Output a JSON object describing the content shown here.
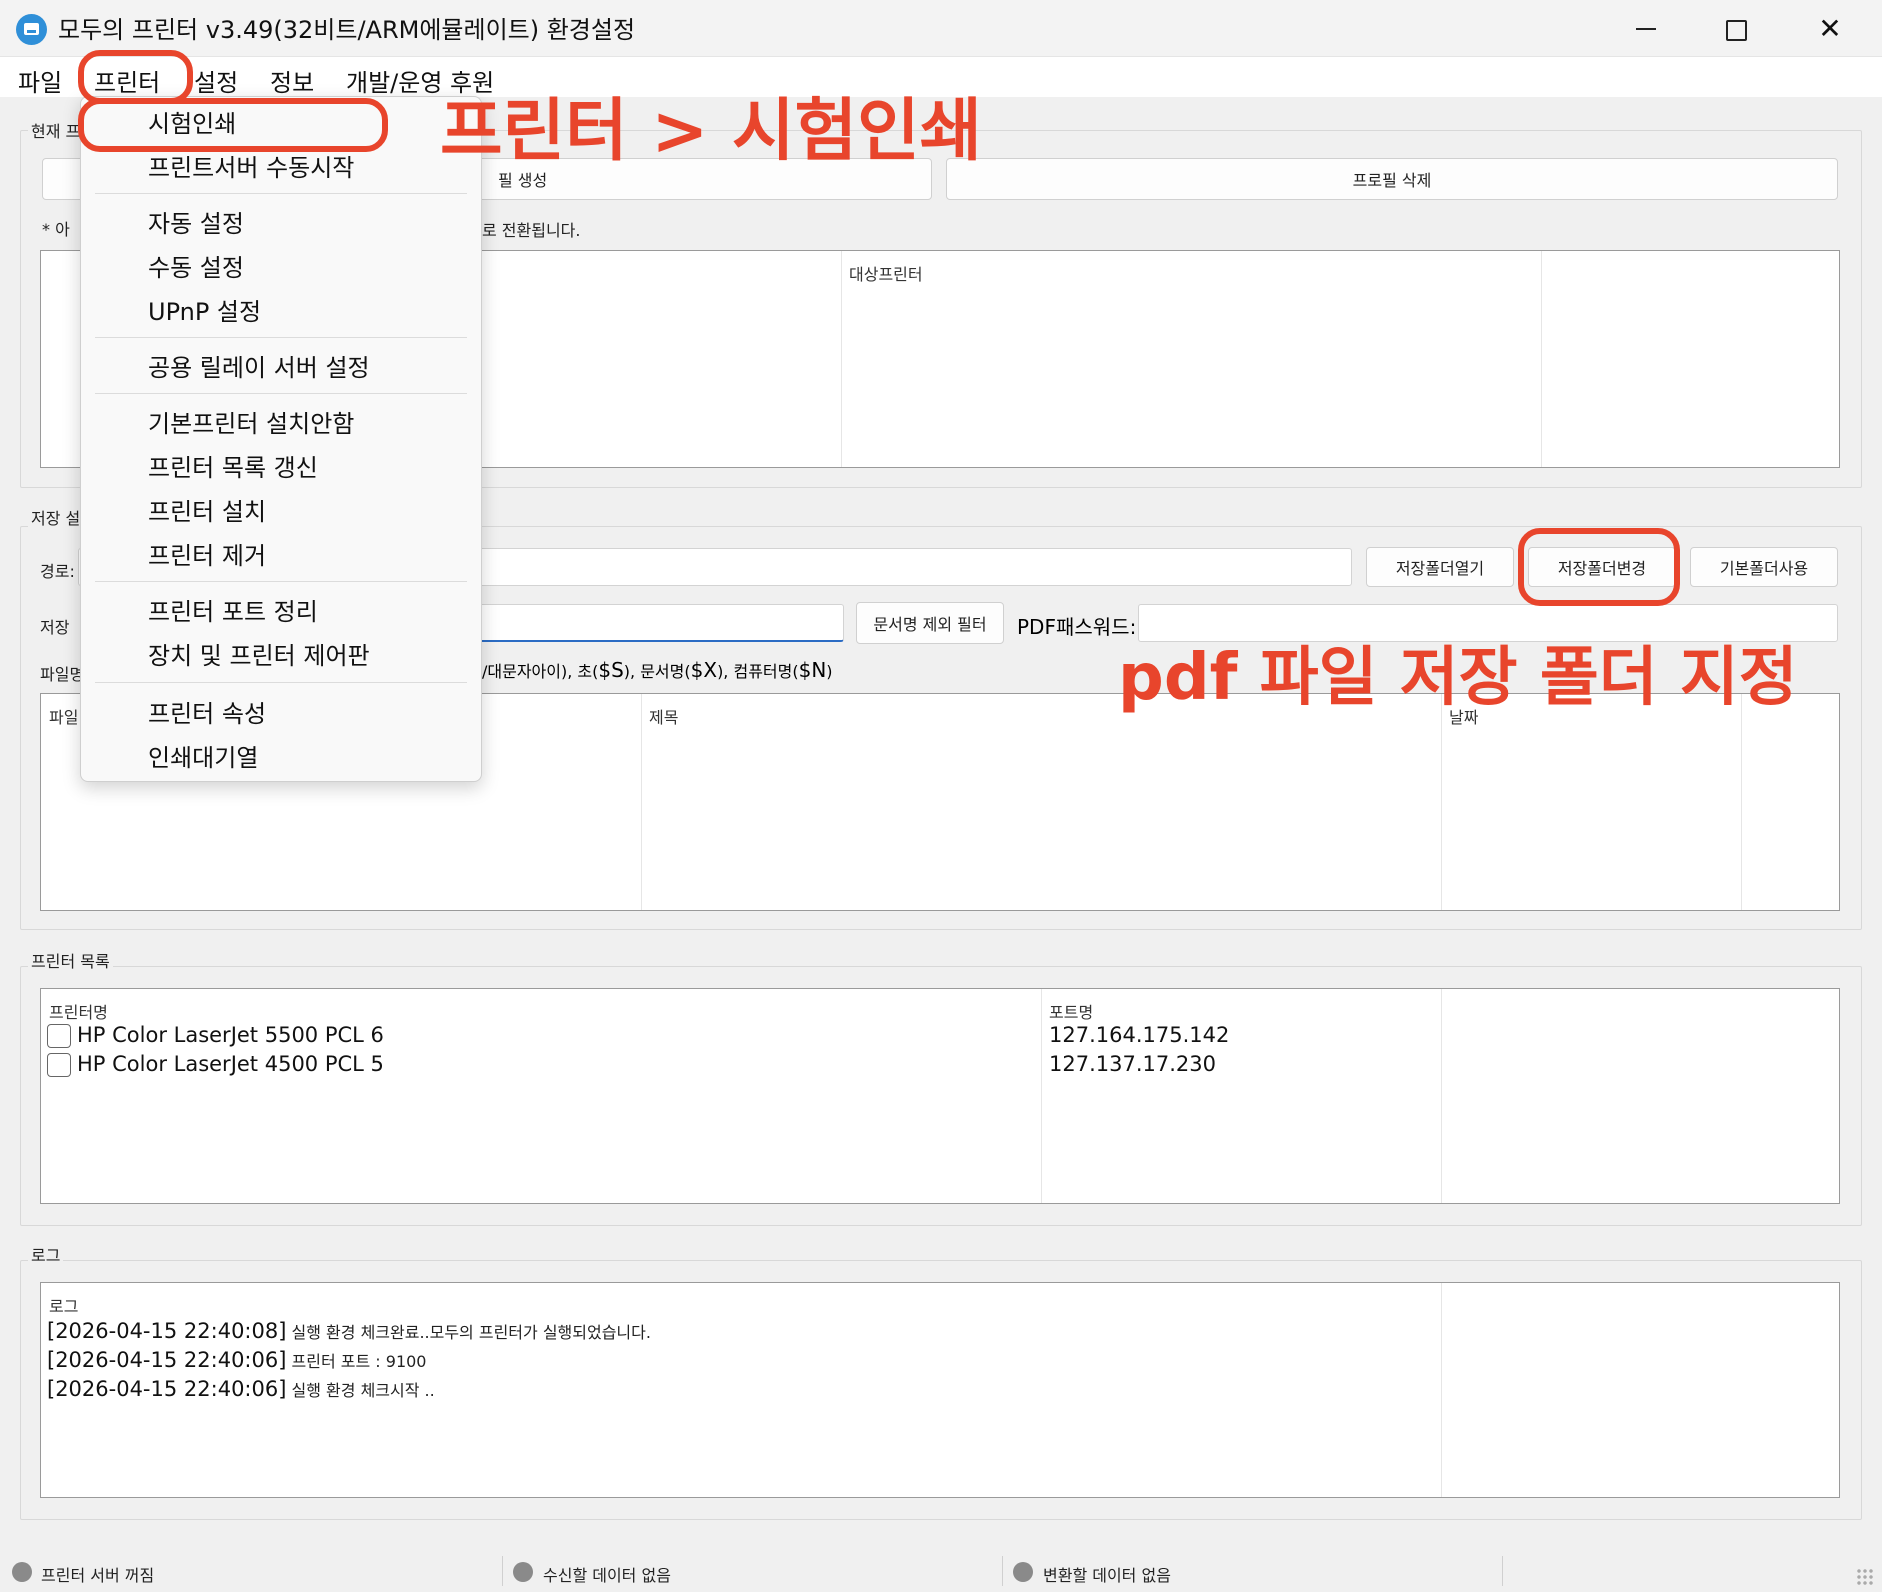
{
  "window": {
    "title": "모두의 프린터 v3.49(32비트/ARM에뮬레이트) 환경설정",
    "minimize_icon": "minimize-icon",
    "maximize_icon": "maximize-icon",
    "close_glyph": "✕"
  },
  "menubar": {
    "items": [
      "파일",
      "프린터",
      "설정",
      "정보",
      "개발/운영 후원"
    ]
  },
  "dropdown": {
    "groups": [
      [
        "시험인쇄",
        "프린트서버 수동시작"
      ],
      [
        "자동 설정",
        "수동 설정",
        "UPnP 설정"
      ],
      [
        "공용 릴레이 서버 설정"
      ],
      [
        "기본프린터 설치안함",
        "프린터 목록 갱신",
        "프린터 설치",
        "프린터 제거"
      ],
      [
        "프린터 포트 정리",
        "장치 및 프린터 제어판"
      ],
      [
        "프린터 속성",
        "인쇄대기열"
      ]
    ]
  },
  "profile_section": {
    "label_visible": "현재 프",
    "create_button_visible": "필 생성",
    "delete_button": "프로필 삭제",
    "note_prefix": "* 아",
    "note_suffix": "로 전환됩니다.",
    "list_column_target_printer": "대상프린터"
  },
  "save_section": {
    "label_visible": "저장 설",
    "path_label": "경로:",
    "open_folder_button": "저장폴더열기",
    "change_folder_button": "저장폴더변경",
    "default_folder_button": "기본폴더사용",
    "save_label_visible": "저장",
    "exclude_filter_button": "문서명 제외 필터",
    "pdf_password_label": "PDF패스워드:",
    "filename_label_visible": "파일명",
    "filename_hint_part1": "/대문자아이), 초(",
    "filename_hint_S": "$S",
    "filename_hint_part2": "), 문서명(",
    "filename_hint_X": "$X",
    "filename_hint_part3": "), 컴퓨터명(",
    "filename_hint_N": "$N",
    "filename_hint_part4": ")",
    "list_column_file_visible": "파일",
    "list_column_title": "제목",
    "list_column_date_visible": "날짜"
  },
  "printer_list": {
    "label": "프린터 목록",
    "columns": [
      "프린터명",
      "포트명"
    ],
    "rows": [
      {
        "name": "HP Color LaserJet 5500 PCL 6",
        "port": "127.164.175.142",
        "checked": false
      },
      {
        "name": "HP Color LaserJet 4500 PCL 5",
        "port": "127.137.17.230",
        "checked": false
      }
    ]
  },
  "log": {
    "label": "로그",
    "column": "로그",
    "entries": [
      {
        "time": "[2026-04-15 22:40:08]",
        "msg": "실행 환경 체크완료..모두의 프린터가 실행되었습니다."
      },
      {
        "time": "[2026-04-15 22:40:06]",
        "msg": "프린터 포트 : 9100"
      },
      {
        "time": "[2026-04-15 22:40:06]",
        "msg": "실행 환경 체크시작 .."
      }
    ]
  },
  "statusbar": {
    "items": [
      "프린터 서버 꺼짐",
      "수신할 데이터 없음",
      "변환할 데이터 없음"
    ],
    "dot_color": "#8a8a8a"
  },
  "annotations": {
    "menu_callout": "프린터 > 시험인쇄",
    "folder_callout": "pdf 파일 저장 폴더 지정",
    "color": "#e8452c"
  }
}
